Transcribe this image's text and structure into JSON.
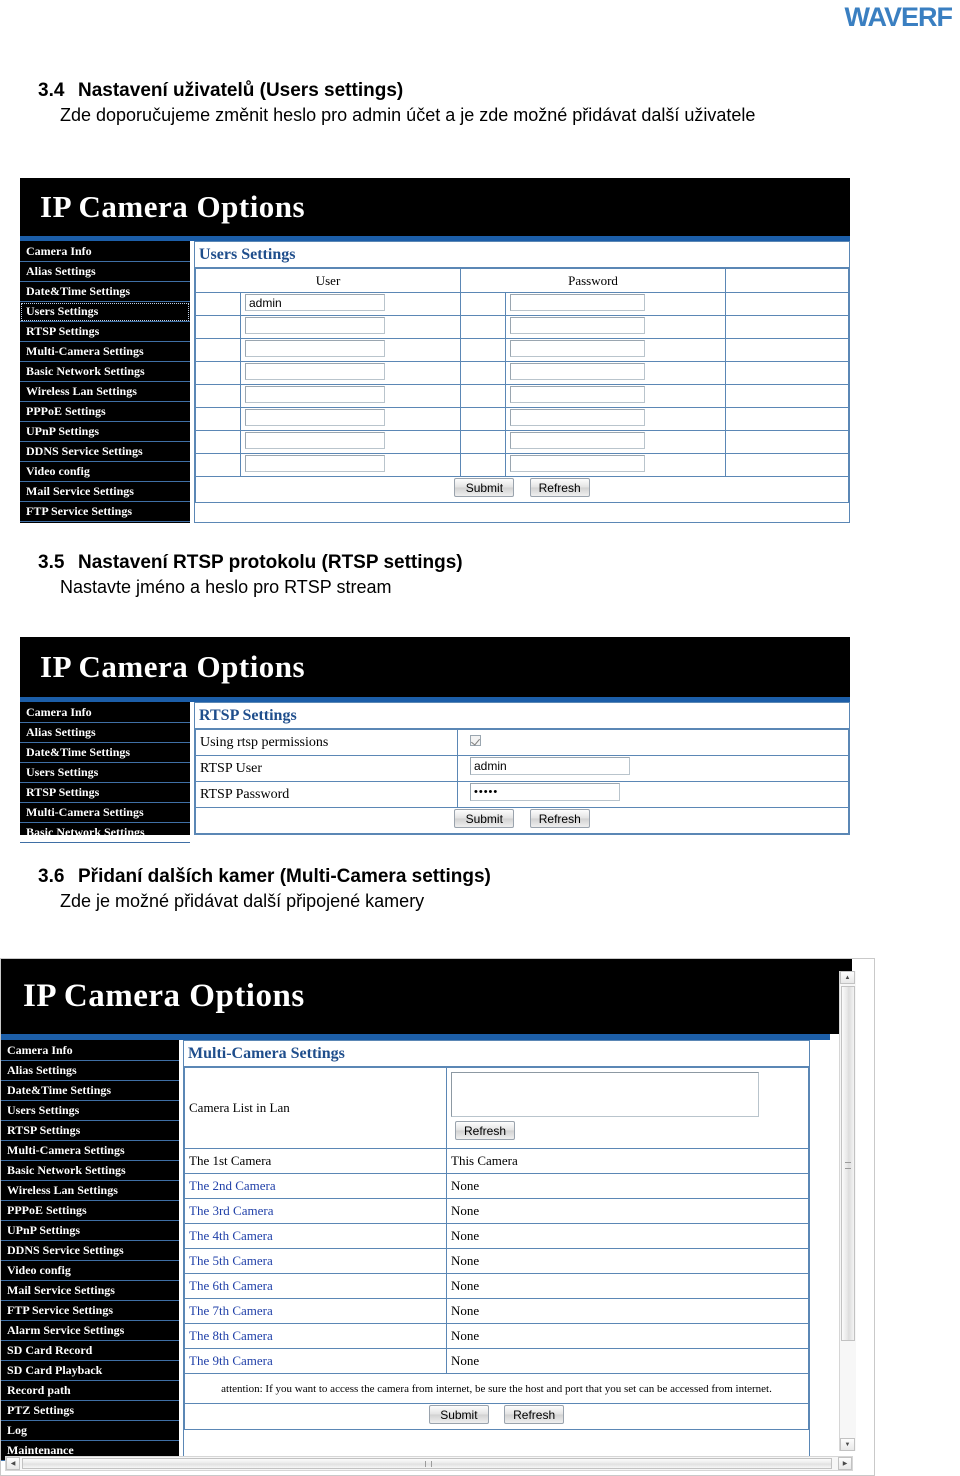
{
  "brand": {
    "logo_text": "WAVERF",
    "logo_color": "#3a7fc1"
  },
  "sections": [
    {
      "number": "3.4",
      "title": "Nastavení uživatelů (Users settings)",
      "body": "Zde doporučujeme změnit heslo pro admin účet a je zde možné přidávat další uživatele"
    },
    {
      "number": "3.5",
      "title": "Nastavení RTSP protokolu (RTSP settings)",
      "body": "Nastavte jméno a heslo pro RTSP stream"
    },
    {
      "number": "3.6",
      "title": "Přidaní dalších kamer (Multi-Camera settings)",
      "body": "Zde je možné přidávat další připojené kamery"
    }
  ],
  "common": {
    "app_title": "IP Camera Options",
    "submit_label": "Submit",
    "refresh_label": "Refresh"
  },
  "panel_users": {
    "app_title": "IP Camera Options",
    "selected_nav": "Users Settings",
    "nav_items": [
      "Camera Info",
      "Alias Settings",
      "Date&Time Settings",
      "Users Settings",
      "RTSP Settings",
      "Multi-Camera Settings",
      "Basic Network Settings",
      "Wireless Lan Settings",
      "PPPoE Settings",
      "UPnP Settings",
      "DDNS Service Settings",
      "Video config",
      "Mail Service Settings",
      "FTP Service Settings"
    ],
    "pane_title": "Users Settings",
    "columns": [
      "User",
      "Password"
    ],
    "rows": [
      {
        "user": "admin",
        "password": ""
      },
      {
        "user": "",
        "password": ""
      },
      {
        "user": "",
        "password": ""
      },
      {
        "user": "",
        "password": ""
      },
      {
        "user": "",
        "password": ""
      },
      {
        "user": "",
        "password": ""
      },
      {
        "user": "",
        "password": ""
      },
      {
        "user": "",
        "password": ""
      }
    ],
    "submit_label": "Submit",
    "refresh_label": "Refresh"
  },
  "panel_rtsp": {
    "app_title": "IP Camera Options",
    "selected_nav": "RTSP Settings",
    "nav_items": [
      "Camera Info",
      "Alias Settings",
      "Date&Time Settings",
      "Users Settings",
      "RTSP Settings",
      "Multi-Camera Settings",
      "Basic Network Settings"
    ],
    "pane_title": "RTSP Settings",
    "fields": [
      {
        "label": "Using rtsp permissions",
        "type": "checkbox",
        "checked": true,
        "value": ""
      },
      {
        "label": "RTSP User",
        "type": "text",
        "value": "admin"
      },
      {
        "label": "RTSP Password",
        "type": "password",
        "value": "•••••"
      }
    ],
    "submit_label": "Submit",
    "refresh_label": "Refresh"
  },
  "panel_multicam": {
    "app_title": "IP Camera Options",
    "selected_nav": "Multi-Camera Settings",
    "nav_items": [
      "Camera Info",
      "Alias Settings",
      "Date&Time Settings",
      "Users Settings",
      "RTSP Settings",
      "Multi-Camera Settings",
      "Basic Network Settings",
      "Wireless Lan Settings",
      "PPPoE Settings",
      "UPnP Settings",
      "DDNS Service Settings",
      "Video config",
      "Mail Service Settings",
      "FTP Service Settings",
      "Alarm Service Settings",
      "SD Card Record",
      "SD Card Playback",
      "Record path",
      "PTZ Settings",
      "Log",
      "Maintenance"
    ],
    "pane_title": "Multi-Camera Settings",
    "camera_list_label": "Camera List in Lan",
    "camera_list_value": "",
    "list_refresh_label": "Refresh",
    "camera_rows": [
      {
        "label": "The 1st Camera",
        "value": "This Camera",
        "link": false
      },
      {
        "label": "The 2nd Camera",
        "value": "None",
        "link": true
      },
      {
        "label": "The 3rd Camera",
        "value": "None",
        "link": true
      },
      {
        "label": "The 4th Camera",
        "value": "None",
        "link": true
      },
      {
        "label": "The 5th Camera",
        "value": "None",
        "link": true
      },
      {
        "label": "The 6th Camera",
        "value": "None",
        "link": true
      },
      {
        "label": "The 7th Camera",
        "value": "None",
        "link": true
      },
      {
        "label": "The 8th Camera",
        "value": "None",
        "link": true
      },
      {
        "label": "The 9th Camera",
        "value": "None",
        "link": true
      }
    ],
    "attention_line1": "attention: If you want to access the camera from internet, be sure the host and port that you set can be accessed",
    "attention_line2": "from internet.",
    "submit_label": "Submit",
    "refresh_label": "Refresh",
    "scroll_up_icon": "▲",
    "scroll_down_icon": "▼",
    "scroll_left_icon": "◀",
    "scroll_right_icon": "▶"
  }
}
